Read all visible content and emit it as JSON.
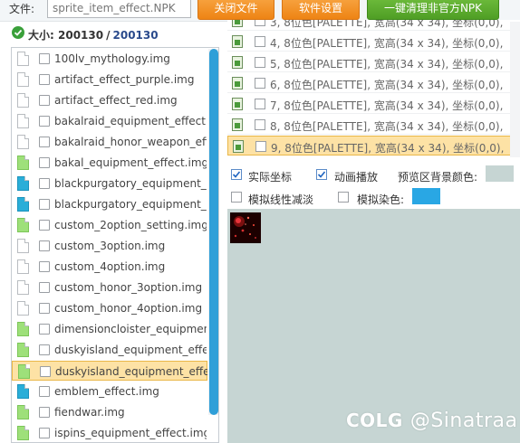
{
  "toolbar": {
    "file_label": "文件:",
    "file_value": "sprite_item_effect.NPK",
    "close_button": "关闭文件",
    "settings_button": "软件设置",
    "clean_button": "一键清理非官方NPK"
  },
  "size": {
    "label": "大小:",
    "value": "200130",
    "separator": "/",
    "total": "200130"
  },
  "files": [
    {
      "name": "100lv_mythology.img",
      "icon": "doc-white",
      "selected": false
    },
    {
      "name": "artifact_effect_purple.img",
      "icon": "doc-white",
      "selected": false
    },
    {
      "name": "artifact_effect_red.img",
      "icon": "doc-white",
      "selected": false
    },
    {
      "name": "bakalraid_equipment_effect.im",
      "icon": "doc-white",
      "selected": false
    },
    {
      "name": "bakalraid_honor_weapon_effe",
      "icon": "doc-white",
      "selected": false
    },
    {
      "name": "bakal_equipment_effect.img",
      "icon": "doc-green",
      "selected": false
    },
    {
      "name": "blackpurgatory_equipment_or.",
      "icon": "doc-blue",
      "selected": false
    },
    {
      "name": "blackpurgatory_equipment_or.",
      "icon": "doc-blue",
      "selected": false
    },
    {
      "name": "custom_2option_setting.img",
      "icon": "doc-green",
      "selected": false
    },
    {
      "name": "custom_3option.img",
      "icon": "doc-white",
      "selected": false
    },
    {
      "name": "custom_4option.img",
      "icon": "doc-white",
      "selected": false
    },
    {
      "name": "custom_honor_3option.img",
      "icon": "doc-white",
      "selected": false
    },
    {
      "name": "custom_honor_4option.img",
      "icon": "doc-white",
      "selected": false
    },
    {
      "name": "dimensioncloister_equipment_",
      "icon": "doc-green",
      "selected": false
    },
    {
      "name": "duskyisland_equipment_effect",
      "icon": "doc-green",
      "selected": false
    },
    {
      "name": "duskyisland_equipment_effect",
      "icon": "doc-green",
      "selected": true
    },
    {
      "name": "emblem_effect.img",
      "icon": "doc-blue",
      "selected": false
    },
    {
      "name": "fiendwar.img",
      "icon": "doc-green",
      "selected": false
    },
    {
      "name": "ispins_equipment_effect.img",
      "icon": "doc-green",
      "selected": false
    }
  ],
  "frames": [
    {
      "text": "3, 8位色[PALETTE], 宽高(34 x 34), 坐标(0,0),",
      "selected": false
    },
    {
      "text": "4, 8位色[PALETTE], 宽高(34 x 34), 坐标(0,0),",
      "selected": false
    },
    {
      "text": "5, 8位色[PALETTE], 宽高(34 x 34), 坐标(0,0),",
      "selected": false
    },
    {
      "text": "6, 8位色[PALETTE], 宽高(34 x 34), 坐标(0,0),",
      "selected": false
    },
    {
      "text": "7, 8位色[PALETTE], 宽高(34 x 34), 坐标(0,0),",
      "selected": false
    },
    {
      "text": "8, 8位色[PALETTE], 宽高(34 x 34), 坐标(0,0),",
      "selected": false
    },
    {
      "text": "9, 8位色[PALETTE], 宽高(34 x 34), 坐标(0,0),",
      "selected": true
    }
  ],
  "options": {
    "actual_coords": "实际坐标",
    "animate": "动画播放",
    "bg_color_label": "预览区背景颜色:",
    "linear_fade": "模拟线性减淡",
    "dye_label": "模拟染色:",
    "actual_coords_checked": true,
    "animate_checked": true,
    "linear_fade_checked": false
  },
  "colors": {
    "bg_swatch": "#c6d5d3",
    "dye_swatch": "#29a7e4",
    "preview_bg": "#c6d5d3",
    "accent_orange": "#f0901e",
    "accent_green": "#5aa82e",
    "selection": "#fde2a5",
    "scrollbar": "#2f9fd8"
  },
  "watermark": {
    "logo": "COLG",
    "text": "@Sinatraa"
  }
}
